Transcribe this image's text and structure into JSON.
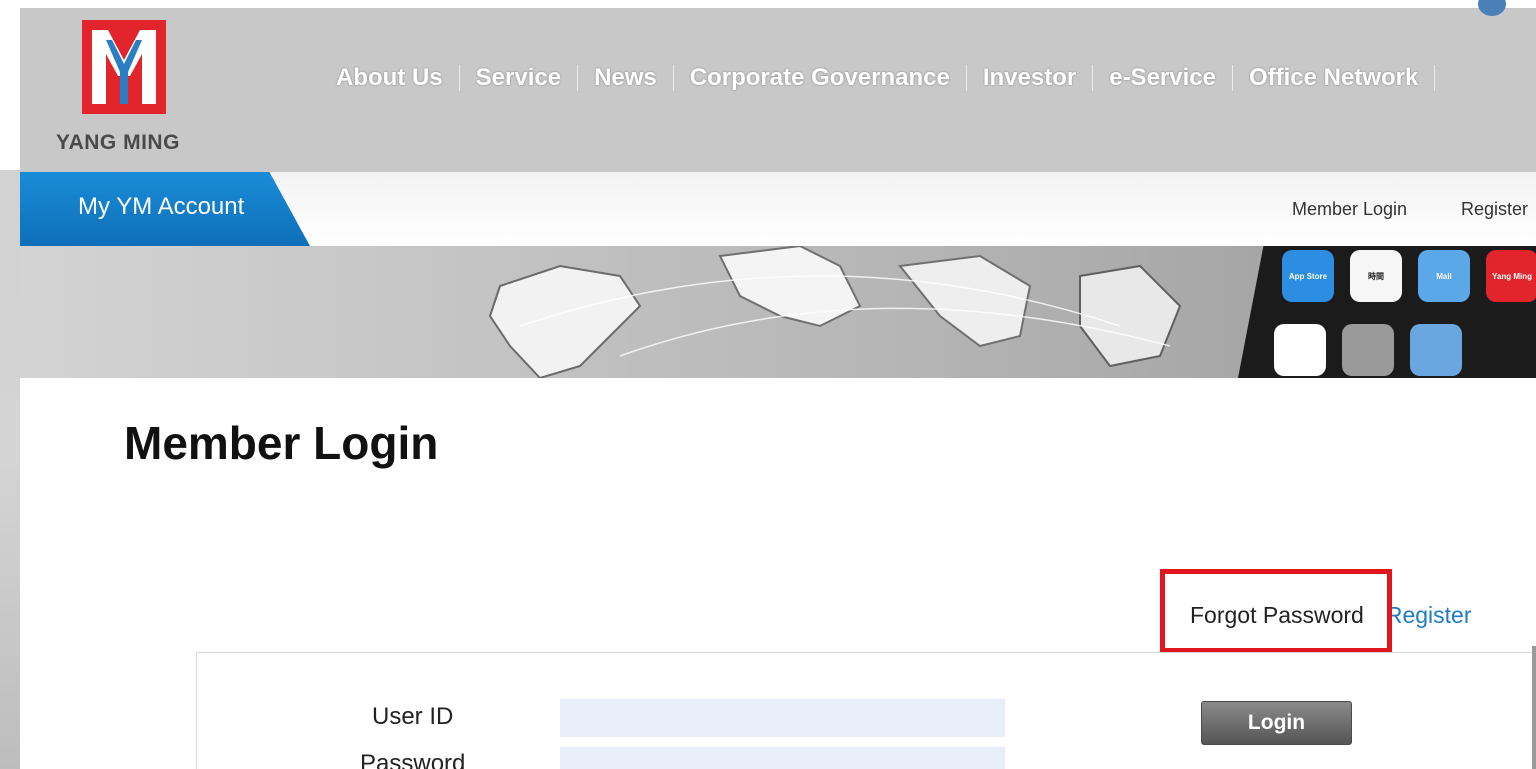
{
  "brand": {
    "logo_text": "YANG MING"
  },
  "main_nav": {
    "items": [
      "About Us",
      "Service",
      "News",
      "Corporate Governance",
      "Investor",
      "e-Service",
      "Office Network"
    ]
  },
  "subnav": {
    "account_tab": "My YM Account",
    "links": [
      "Member Login",
      "Register"
    ]
  },
  "banner": {
    "app_labels": [
      "App Store",
      "時間",
      "Mail",
      "Yang Ming"
    ]
  },
  "page": {
    "title": "Member Login"
  },
  "login_links": {
    "forgot_password": "Forgot Password",
    "register": "Register"
  },
  "form": {
    "user_id_label": "User ID",
    "user_id_value": "",
    "password_label": "Password",
    "password_value": "",
    "login_button": "Login"
  },
  "colors": {
    "brand_red": "#e2252d",
    "brand_blue": "#1a8cd8",
    "link_blue": "#1f7cc2",
    "highlight_red": "#e0161c",
    "input_bg": "#e8eef7"
  }
}
